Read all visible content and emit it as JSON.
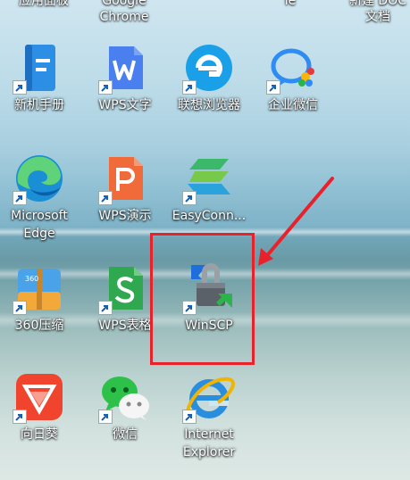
{
  "top_partial_labels": [
    "应用面板",
    "Google\nChrome",
    "ie",
    "新建 DOC\n文档"
  ],
  "desktop_icons": [
    {
      "label": "新机手册",
      "icon": "manual-icon"
    },
    {
      "label": "WPS文字",
      "icon": "wps-writer-icon"
    },
    {
      "label": "联想浏览器",
      "icon": "lenovo-browser-icon"
    },
    {
      "label": "企业微信",
      "icon": "wecom-icon"
    },
    {
      "label": "Microsoft\nEdge",
      "icon": "edge-icon"
    },
    {
      "label": "WPS演示",
      "icon": "wps-presentation-icon"
    },
    {
      "label": "EasyConn...",
      "icon": "easyconnect-icon"
    },
    {
      "label": "360压缩",
      "icon": "360-zip-icon"
    },
    {
      "label": "WPS表格",
      "icon": "wps-spreadsheet-icon"
    },
    {
      "label": "WinSCP",
      "icon": "winscp-icon"
    },
    {
      "label": "向日葵",
      "icon": "sunlogin-icon"
    },
    {
      "label": "微信",
      "icon": "wechat-icon"
    },
    {
      "label": "Internet\nExplorer",
      "icon": "ie-icon"
    }
  ],
  "colors": {
    "highlight": "#e8222a",
    "arrow": "#e8222a"
  }
}
